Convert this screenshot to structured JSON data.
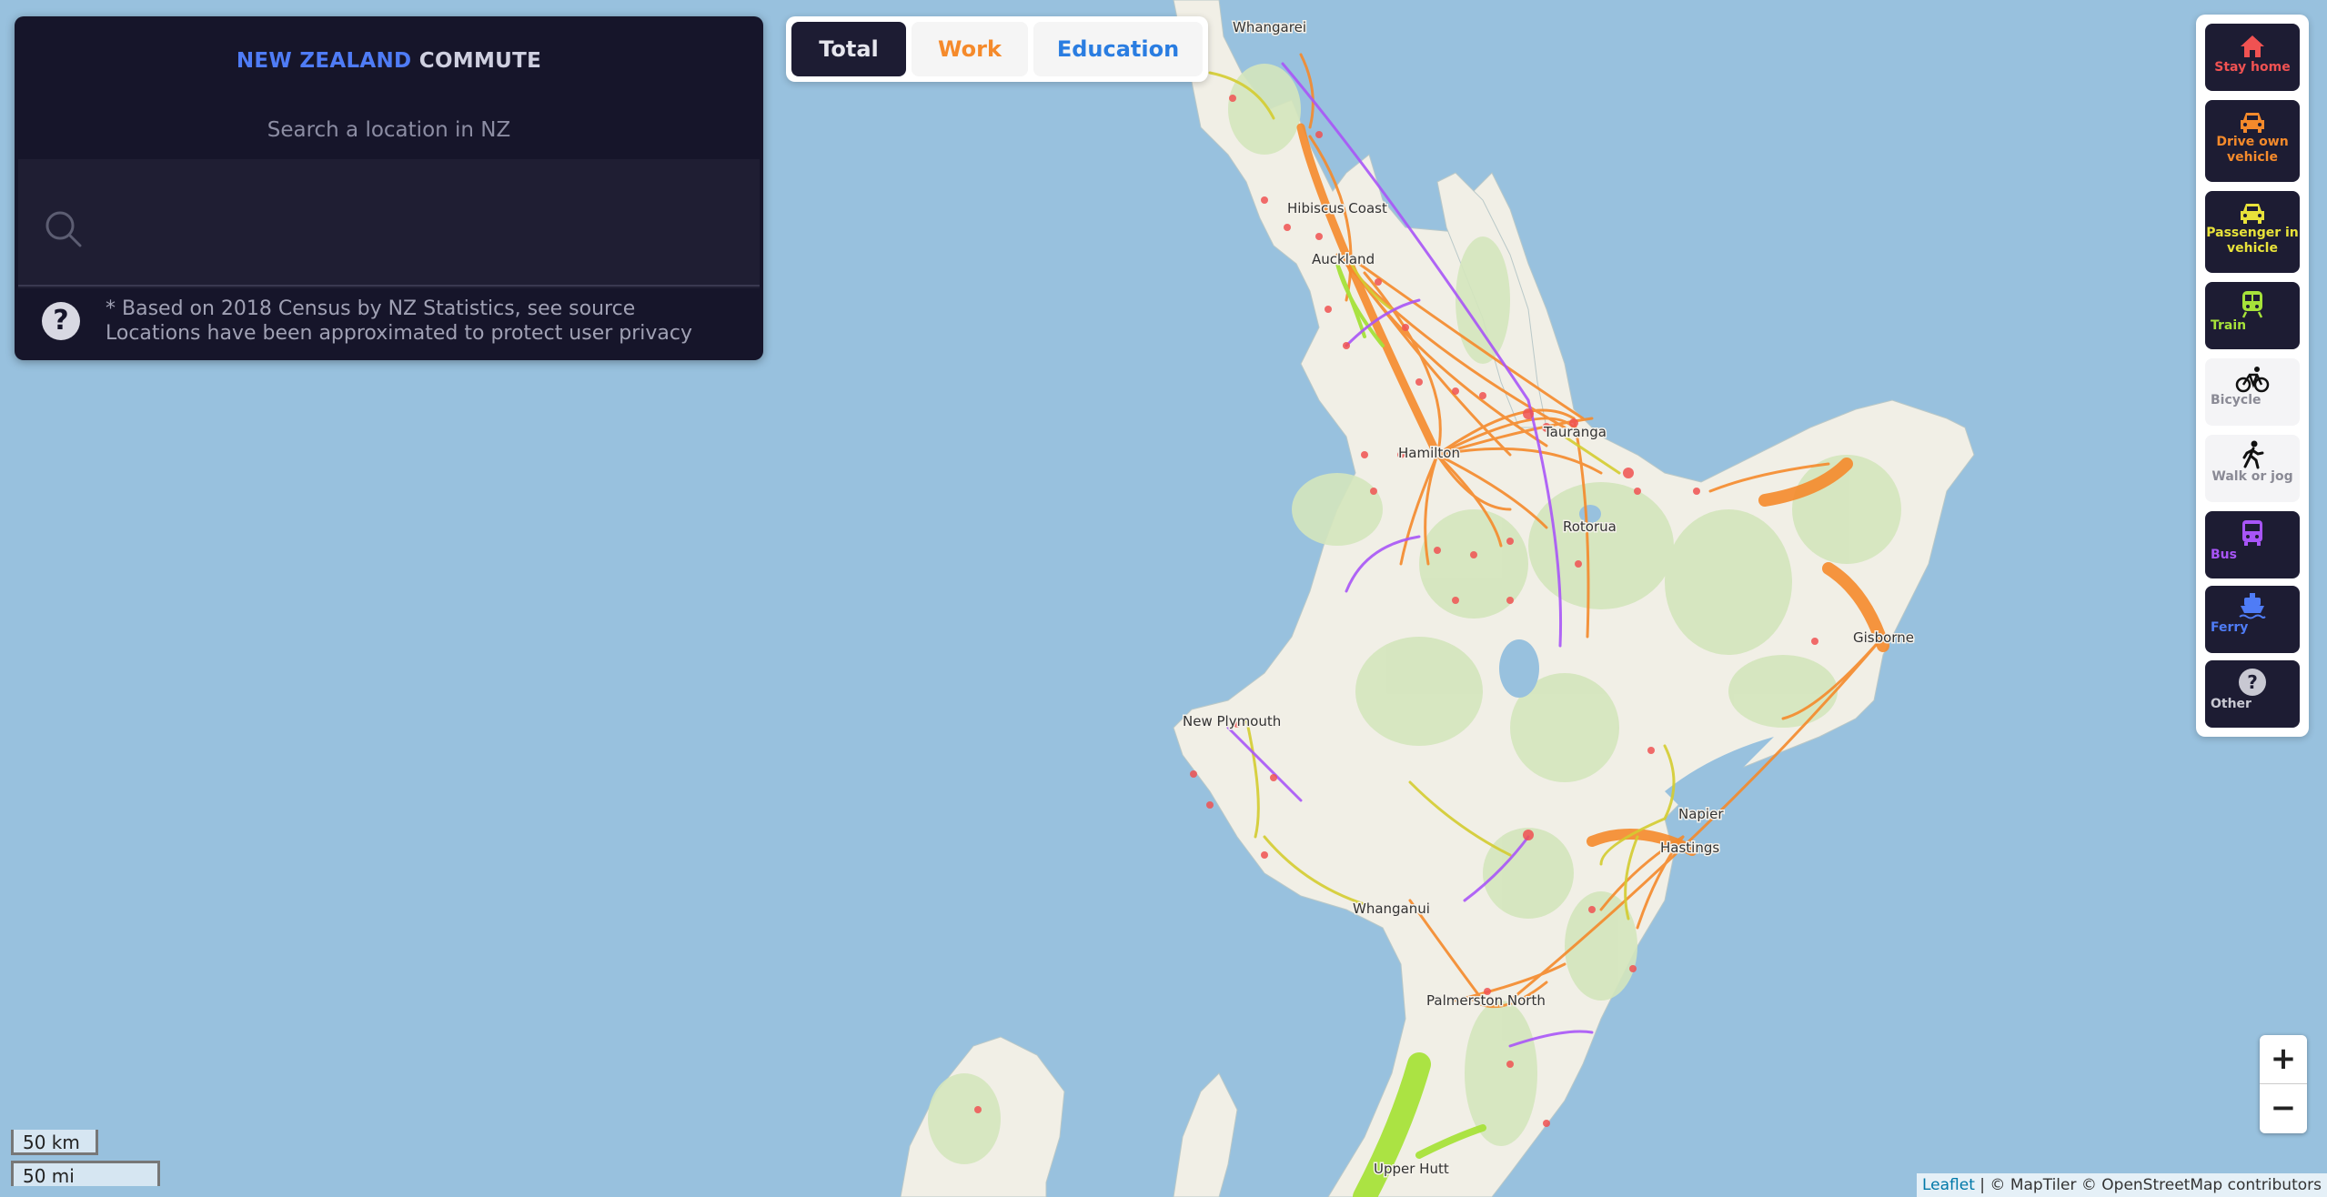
{
  "panel": {
    "title_country": "NEW ZEALAND",
    "title_app": "COMMUTE",
    "subtitle": "Search a location in NZ",
    "search_value": "",
    "note_line1": "* Based on 2018 Census by NZ Statistics, see source",
    "note_line2": "Locations have been approximated to protect user privacy",
    "help_glyph": "?"
  },
  "tabs": [
    {
      "label": "Total",
      "active": true,
      "color": "#e6e6ee"
    },
    {
      "label": "Work",
      "active": false,
      "color": "#f58a2b"
    },
    {
      "label": "Education",
      "active": false,
      "color": "#2a7de1"
    }
  ],
  "modes": [
    {
      "label": "Stay home",
      "icon": "house-icon",
      "color": "#f05252"
    },
    {
      "label": "Drive own vehicle",
      "icon": "car-icon",
      "color": "#f58a2b"
    },
    {
      "label": "Passenger in vehicle",
      "icon": "car-icon",
      "color": "#e8e23a"
    },
    {
      "label": "Train",
      "icon": "train-icon",
      "color": "#a6e23a"
    },
    {
      "label": "Bicycle",
      "icon": "bicycle-icon",
      "color": "#8a8a95"
    },
    {
      "label": "Walk or jog",
      "icon": "walking-person-icon",
      "color": "#8a8a95"
    },
    {
      "label": "Bus",
      "icon": "bus-icon",
      "color": "#a855f7"
    },
    {
      "label": "Ferry",
      "icon": "ferry-icon",
      "color": "#4f7cf6"
    },
    {
      "label": "Other",
      "icon": "question-icon",
      "color": "#c8c8d2"
    }
  ],
  "map": {
    "places": [
      "Whangarei",
      "Hibiscus Coast",
      "Auckland",
      "Tauranga",
      "Hamilton",
      "Rotorua",
      "Gisborne",
      "New Plymouth",
      "Napier",
      "Hastings",
      "Whanganui",
      "Palmerston North",
      "Upper Hutt"
    ],
    "colors": {
      "water": "#98c1de",
      "land": "#f1efe6",
      "forest": "#d4e6bc",
      "stay_home": "#f05252",
      "drive": "#f58a2b",
      "passenger": "#d4cc30",
      "train": "#a6e23a",
      "bus": "#a855f7"
    }
  },
  "zoom": {
    "in_label": "+",
    "out_label": "−"
  },
  "scale": {
    "km": "50 km",
    "mi": "50 mi"
  },
  "attribution": {
    "leaflet": "Leaflet",
    "rest": " | © MapTiler © OpenStreetMap contributors"
  }
}
